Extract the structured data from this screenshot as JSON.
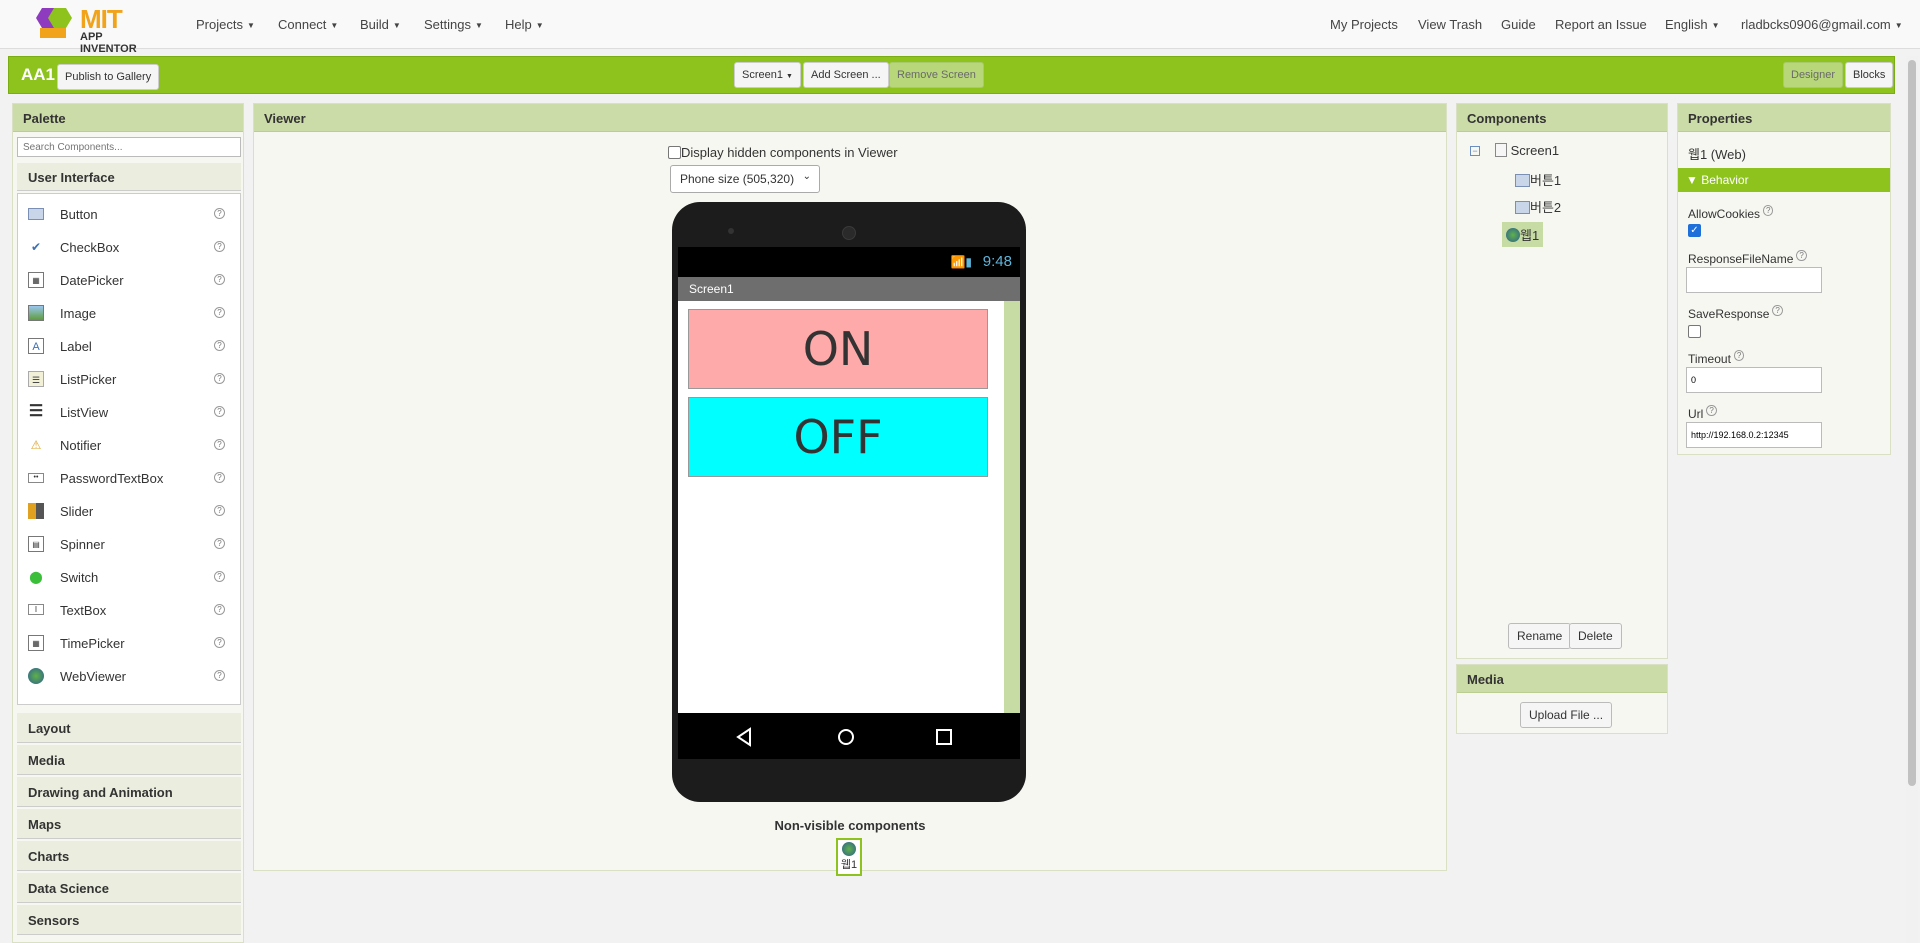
{
  "nav": {
    "logo_main": "MIT",
    "logo_sub": "APP INVENTOR",
    "menus": [
      "Projects",
      "Connect",
      "Build",
      "Settings",
      "Help"
    ],
    "right_links": [
      "My Projects",
      "View Trash",
      "Guide",
      "Report an Issue"
    ],
    "language": "English",
    "account": "rladbcks0906@gmail.com"
  },
  "toolbar": {
    "project_name": "AA1",
    "publish_label": "Publish to Gallery",
    "screen_select": "Screen1",
    "add_screen": "Add Screen ...",
    "remove_screen": "Remove Screen",
    "designer": "Designer",
    "blocks": "Blocks"
  },
  "palette": {
    "title": "Palette",
    "search_placeholder": "Search Components...",
    "active_category": "User Interface",
    "items": [
      "Button",
      "CheckBox",
      "DatePicker",
      "Image",
      "Label",
      "ListPicker",
      "ListView",
      "Notifier",
      "PasswordTextBox",
      "Slider",
      "Spinner",
      "Switch",
      "TextBox",
      "TimePicker",
      "WebViewer"
    ],
    "categories": [
      "Layout",
      "Media",
      "Drawing and Animation",
      "Maps",
      "Charts",
      "Data Science",
      "Sensors"
    ]
  },
  "viewer": {
    "title": "Viewer",
    "hidden_label": "Display hidden components in Viewer",
    "phone_size": "Phone size (505,320)",
    "status_time": "9:48",
    "screen_title": "Screen1",
    "button_on": "ON",
    "button_off": "OFF",
    "on_color": "#ffaaaa",
    "off_color": "#00ffff",
    "nonvisible_title": "Non-visible components",
    "nonvisible_item": "웹1"
  },
  "components": {
    "title": "Components",
    "tree": [
      "Screen1",
      "버튼1",
      "버튼2",
      "웹1"
    ],
    "selected": "웹1",
    "rename": "Rename",
    "delete": "Delete"
  },
  "media": {
    "title": "Media",
    "upload": "Upload File ..."
  },
  "properties": {
    "title": "Properties",
    "component": "웹1 (Web)",
    "group": "Behavior",
    "allow_cookies_label": "AllowCookies",
    "allow_cookies": true,
    "response_file_label": "ResponseFileName",
    "response_file": "",
    "save_response_label": "SaveResponse",
    "save_response": false,
    "timeout_label": "Timeout",
    "timeout": "0",
    "url_label": "Url",
    "url": "http://192.168.0.2:12345"
  }
}
